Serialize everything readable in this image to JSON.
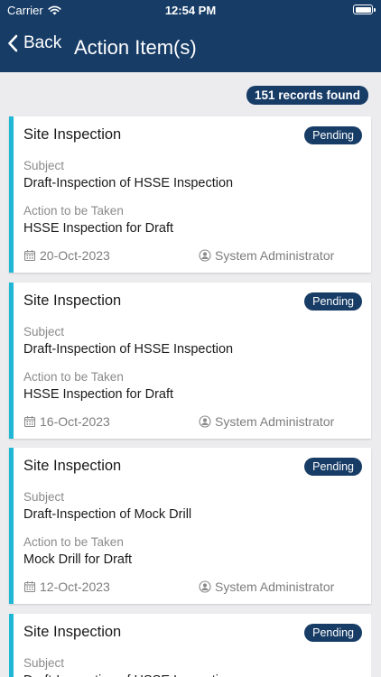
{
  "status_bar": {
    "carrier": "Carrier",
    "time": "12:54 PM"
  },
  "nav": {
    "back_label": "Back",
    "title": "Action Item(s)"
  },
  "records_found": "151 records found",
  "colors": {
    "header": "#173c66",
    "accent": "#1fb7d3",
    "background": "#ececef"
  },
  "labels": {
    "subject": "Subject",
    "action": "Action to be Taken"
  },
  "items": [
    {
      "title": "Site Inspection",
      "status": "Pending",
      "subject": "Draft-Inspection of HSSE Inspection",
      "action": "HSSE Inspection for Draft",
      "date": "20-Oct-2023",
      "user": "System Administrator"
    },
    {
      "title": "Site Inspection",
      "status": "Pending",
      "subject": "Draft-Inspection of HSSE Inspection",
      "action": "HSSE Inspection for Draft",
      "date": "16-Oct-2023",
      "user": "System Administrator"
    },
    {
      "title": "Site Inspection",
      "status": "Pending",
      "subject": "Draft-Inspection of Mock Drill",
      "action": "Mock Drill for Draft",
      "date": "12-Oct-2023",
      "user": "System Administrator"
    },
    {
      "title": "Site Inspection",
      "status": "Pending",
      "subject": "Draft-Inspection of HSSE Inspection",
      "action": "",
      "date": "",
      "user": ""
    }
  ]
}
